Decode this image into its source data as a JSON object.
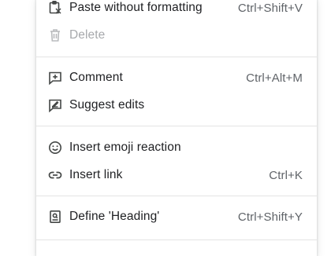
{
  "menu": {
    "items": [
      {
        "label": "Paste without formatting",
        "shortcut": "Ctrl+Shift+V",
        "icon": "paste-plain-icon",
        "disabled": false
      },
      {
        "label": "Delete",
        "shortcut": "",
        "icon": "trash-icon",
        "disabled": true
      },
      {
        "label": "Comment",
        "shortcut": "Ctrl+Alt+M",
        "icon": "add-comment-icon",
        "disabled": false
      },
      {
        "label": "Suggest edits",
        "shortcut": "",
        "icon": "suggest-edit-icon",
        "disabled": false
      },
      {
        "label": "Insert emoji reaction",
        "shortcut": "",
        "icon": "emoji-icon",
        "disabled": false
      },
      {
        "label": "Insert link",
        "shortcut": "Ctrl+K",
        "icon": "link-icon",
        "disabled": false
      },
      {
        "label": "Define 'Heading'",
        "shortcut": "Ctrl+Shift+Y",
        "icon": "dictionary-icon",
        "disabled": false
      }
    ]
  },
  "colors": {
    "text": "#202124",
    "shortcut": "#5f6368",
    "disabled": "#a7a9ac",
    "separator": "#e3e3e3"
  }
}
